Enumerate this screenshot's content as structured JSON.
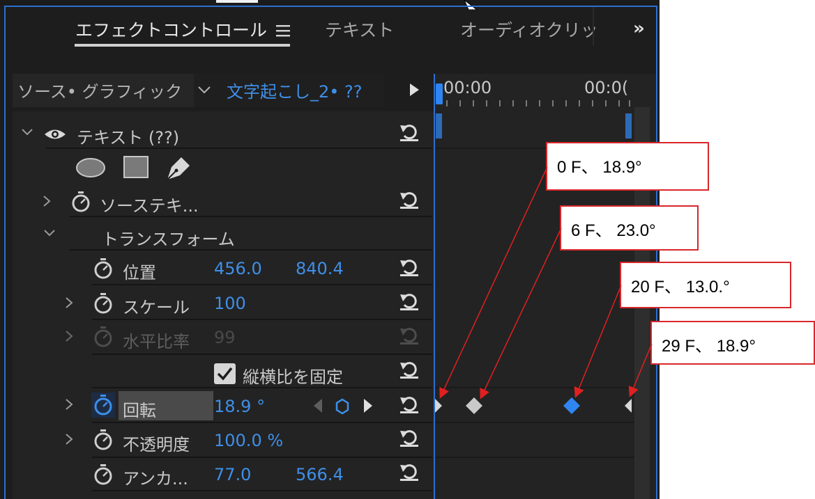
{
  "tabs": [
    {
      "label": "エフェクトコントロール",
      "active": true
    },
    {
      "label": "テキスト",
      "active": false
    },
    {
      "label": "オーディオクリッ",
      "active": false
    }
  ],
  "source": {
    "label": "ソース• グラフィック",
    "clip": "文字起こし_2• ??"
  },
  "timecodes": [
    "00:00",
    "00:0("
  ],
  "rows": {
    "text_group": "テキスト (??)",
    "source_text": "ソーステキ...",
    "transform": "トランスフォーム",
    "position": {
      "label": "位置",
      "x": "456.0",
      "y": "840.4"
    },
    "scale": {
      "label": "スケール",
      "value": "100"
    },
    "h_ratio": {
      "label": "水平比率",
      "value": "99"
    },
    "uniform": {
      "label": "縦横比を固定",
      "checked": true
    },
    "rotation": {
      "label": "回転",
      "value": "18.9 °"
    },
    "opacity": {
      "label": "不透明度",
      "value": "100.0 %"
    },
    "anchor": {
      "label": "アンカ...",
      "x": "77.0",
      "y": "566.4"
    }
  },
  "callouts": [
    "0 F、 18.9°",
    "6 F、 23.0°",
    "20 F、 13.0.°",
    "29 F、 18.9°"
  ],
  "colors": {
    "accent": "#3f8fe8",
    "callout_border": "#d9262b",
    "panel": "#1d1d1d"
  }
}
